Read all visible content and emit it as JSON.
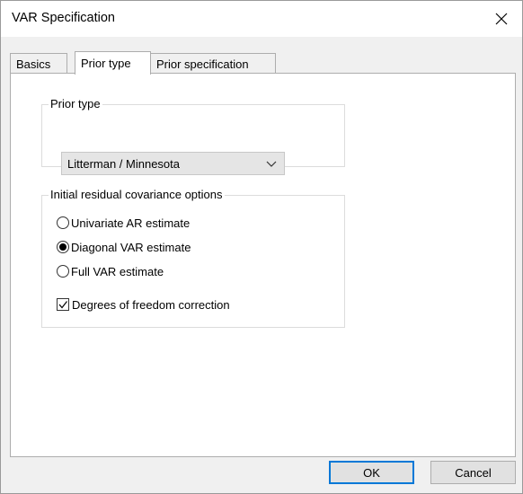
{
  "window": {
    "title": "VAR Specification"
  },
  "tabs": [
    {
      "label": "Basics",
      "active": false
    },
    {
      "label": "Prior type",
      "active": true
    },
    {
      "label": "Prior specification",
      "active": false
    }
  ],
  "prior_type": {
    "legend": "Prior type",
    "selected": "Litterman / Minnesota"
  },
  "covariance": {
    "legend": "Initial residual covariance options",
    "options": [
      {
        "label": "Univariate AR estimate",
        "checked": false
      },
      {
        "label": "Diagonal VAR estimate",
        "checked": true
      },
      {
        "label": "Full VAR estimate",
        "checked": false
      }
    ],
    "dof_correction": {
      "label": "Degrees of freedom correction",
      "checked": true
    }
  },
  "buttons": {
    "ok": "OK",
    "cancel": "Cancel"
  },
  "icons": {
    "close": "close-icon",
    "dropdown": "chevron-down-icon",
    "check": "checkmark-icon"
  },
  "colors": {
    "accent": "#0078d7",
    "window_bg": "#f0f0f0",
    "panel_bg": "#ffffff"
  }
}
